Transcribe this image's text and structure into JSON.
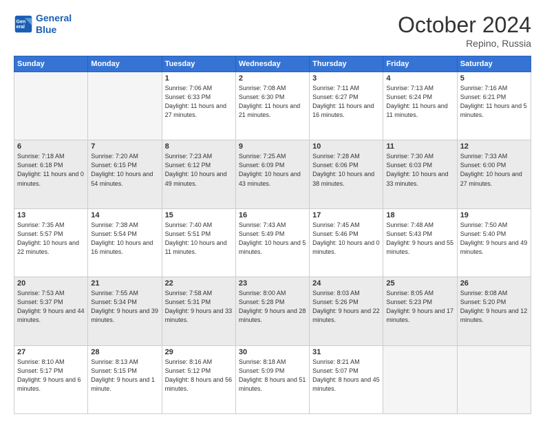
{
  "header": {
    "logo_line1": "General",
    "logo_line2": "Blue",
    "month": "October 2024",
    "location": "Repino, Russia"
  },
  "days_of_week": [
    "Sunday",
    "Monday",
    "Tuesday",
    "Wednesday",
    "Thursday",
    "Friday",
    "Saturday"
  ],
  "weeks": [
    [
      {
        "day": "",
        "empty": true
      },
      {
        "day": "",
        "empty": true
      },
      {
        "day": "1",
        "sunrise": "Sunrise: 7:06 AM",
        "sunset": "Sunset: 6:33 PM",
        "daylight": "Daylight: 11 hours and 27 minutes."
      },
      {
        "day": "2",
        "sunrise": "Sunrise: 7:08 AM",
        "sunset": "Sunset: 6:30 PM",
        "daylight": "Daylight: 11 hours and 21 minutes."
      },
      {
        "day": "3",
        "sunrise": "Sunrise: 7:11 AM",
        "sunset": "Sunset: 6:27 PM",
        "daylight": "Daylight: 11 hours and 16 minutes."
      },
      {
        "day": "4",
        "sunrise": "Sunrise: 7:13 AM",
        "sunset": "Sunset: 6:24 PM",
        "daylight": "Daylight: 11 hours and 11 minutes."
      },
      {
        "day": "5",
        "sunrise": "Sunrise: 7:16 AM",
        "sunset": "Sunset: 6:21 PM",
        "daylight": "Daylight: 11 hours and 5 minutes."
      }
    ],
    [
      {
        "day": "6",
        "sunrise": "Sunrise: 7:18 AM",
        "sunset": "Sunset: 6:18 PM",
        "daylight": "Daylight: 11 hours and 0 minutes."
      },
      {
        "day": "7",
        "sunrise": "Sunrise: 7:20 AM",
        "sunset": "Sunset: 6:15 PM",
        "daylight": "Daylight: 10 hours and 54 minutes."
      },
      {
        "day": "8",
        "sunrise": "Sunrise: 7:23 AM",
        "sunset": "Sunset: 6:12 PM",
        "daylight": "Daylight: 10 hours and 49 minutes."
      },
      {
        "day": "9",
        "sunrise": "Sunrise: 7:25 AM",
        "sunset": "Sunset: 6:09 PM",
        "daylight": "Daylight: 10 hours and 43 minutes."
      },
      {
        "day": "10",
        "sunrise": "Sunrise: 7:28 AM",
        "sunset": "Sunset: 6:06 PM",
        "daylight": "Daylight: 10 hours and 38 minutes."
      },
      {
        "day": "11",
        "sunrise": "Sunrise: 7:30 AM",
        "sunset": "Sunset: 6:03 PM",
        "daylight": "Daylight: 10 hours and 33 minutes."
      },
      {
        "day": "12",
        "sunrise": "Sunrise: 7:33 AM",
        "sunset": "Sunset: 6:00 PM",
        "daylight": "Daylight: 10 hours and 27 minutes."
      }
    ],
    [
      {
        "day": "13",
        "sunrise": "Sunrise: 7:35 AM",
        "sunset": "Sunset: 5:57 PM",
        "daylight": "Daylight: 10 hours and 22 minutes."
      },
      {
        "day": "14",
        "sunrise": "Sunrise: 7:38 AM",
        "sunset": "Sunset: 5:54 PM",
        "daylight": "Daylight: 10 hours and 16 minutes."
      },
      {
        "day": "15",
        "sunrise": "Sunrise: 7:40 AM",
        "sunset": "Sunset: 5:51 PM",
        "daylight": "Daylight: 10 hours and 11 minutes."
      },
      {
        "day": "16",
        "sunrise": "Sunrise: 7:43 AM",
        "sunset": "Sunset: 5:49 PM",
        "daylight": "Daylight: 10 hours and 5 minutes."
      },
      {
        "day": "17",
        "sunrise": "Sunrise: 7:45 AM",
        "sunset": "Sunset: 5:46 PM",
        "daylight": "Daylight: 10 hours and 0 minutes."
      },
      {
        "day": "18",
        "sunrise": "Sunrise: 7:48 AM",
        "sunset": "Sunset: 5:43 PM",
        "daylight": "Daylight: 9 hours and 55 minutes."
      },
      {
        "day": "19",
        "sunrise": "Sunrise: 7:50 AM",
        "sunset": "Sunset: 5:40 PM",
        "daylight": "Daylight: 9 hours and 49 minutes."
      }
    ],
    [
      {
        "day": "20",
        "sunrise": "Sunrise: 7:53 AM",
        "sunset": "Sunset: 5:37 PM",
        "daylight": "Daylight: 9 hours and 44 minutes."
      },
      {
        "day": "21",
        "sunrise": "Sunrise: 7:55 AM",
        "sunset": "Sunset: 5:34 PM",
        "daylight": "Daylight: 9 hours and 39 minutes."
      },
      {
        "day": "22",
        "sunrise": "Sunrise: 7:58 AM",
        "sunset": "Sunset: 5:31 PM",
        "daylight": "Daylight: 9 hours and 33 minutes."
      },
      {
        "day": "23",
        "sunrise": "Sunrise: 8:00 AM",
        "sunset": "Sunset: 5:28 PM",
        "daylight": "Daylight: 9 hours and 28 minutes."
      },
      {
        "day": "24",
        "sunrise": "Sunrise: 8:03 AM",
        "sunset": "Sunset: 5:26 PM",
        "daylight": "Daylight: 9 hours and 22 minutes."
      },
      {
        "day": "25",
        "sunrise": "Sunrise: 8:05 AM",
        "sunset": "Sunset: 5:23 PM",
        "daylight": "Daylight: 9 hours and 17 minutes."
      },
      {
        "day": "26",
        "sunrise": "Sunrise: 8:08 AM",
        "sunset": "Sunset: 5:20 PM",
        "daylight": "Daylight: 9 hours and 12 minutes."
      }
    ],
    [
      {
        "day": "27",
        "sunrise": "Sunrise: 8:10 AM",
        "sunset": "Sunset: 5:17 PM",
        "daylight": "Daylight: 9 hours and 6 minutes."
      },
      {
        "day": "28",
        "sunrise": "Sunrise: 8:13 AM",
        "sunset": "Sunset: 5:15 PM",
        "daylight": "Daylight: 9 hours and 1 minute."
      },
      {
        "day": "29",
        "sunrise": "Sunrise: 8:16 AM",
        "sunset": "Sunset: 5:12 PM",
        "daylight": "Daylight: 8 hours and 56 minutes."
      },
      {
        "day": "30",
        "sunrise": "Sunrise: 8:18 AM",
        "sunset": "Sunset: 5:09 PM",
        "daylight": "Daylight: 8 hours and 51 minutes."
      },
      {
        "day": "31",
        "sunrise": "Sunrise: 8:21 AM",
        "sunset": "Sunset: 5:07 PM",
        "daylight": "Daylight: 8 hours and 45 minutes."
      },
      {
        "day": "",
        "empty": true
      },
      {
        "day": "",
        "empty": true
      }
    ]
  ]
}
